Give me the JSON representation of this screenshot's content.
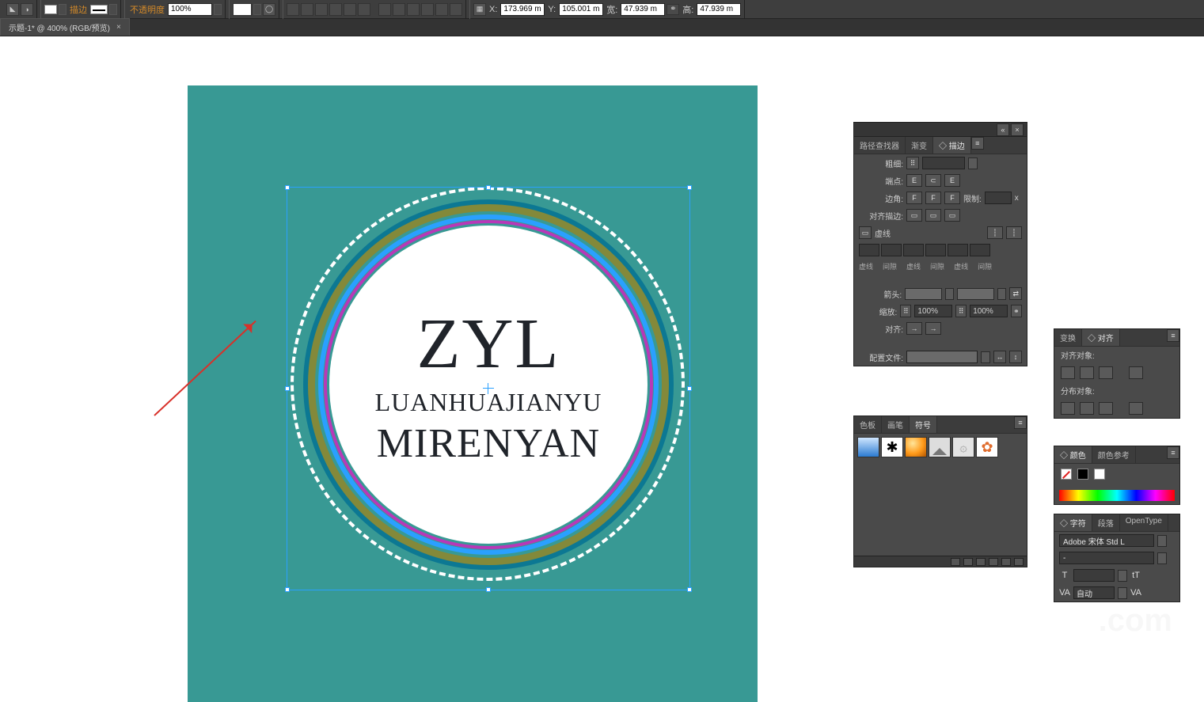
{
  "topbar": {
    "stroke_label": "描边",
    "opacity_label": "不透明度",
    "opacity_value": "100%",
    "x_label": "X:",
    "x_value": "173.969 m",
    "y_label": "Y:",
    "y_value": "105.001 m",
    "w_label": "宽:",
    "w_value": "47.939 m",
    "h_label": "高:",
    "h_value": "47.939 m"
  },
  "document_tab": {
    "title": "示题-1* @ 400% (RGB/预览)",
    "close": "×"
  },
  "artwork": {
    "line1": "ZYL",
    "line2": "LUANHUAJIANYU",
    "line3": "MIRENYAN"
  },
  "stroke_panel": {
    "tabs": [
      "路径查找器",
      "渐变",
      "◇ 描边"
    ],
    "weight_label": "粗细:",
    "cap_label": "端点:",
    "corner_label": "边角:",
    "limit_label": "限制:",
    "align_stroke_label": "对齐描边:",
    "dash_label": "虚线",
    "dash_cols": [
      "虚线",
      "间隙",
      "虚线",
      "间隙",
      "虚线",
      "间隙"
    ],
    "arrow_label": "箭头:",
    "scale_label": "缩放:",
    "scale_value_a": "100%",
    "scale_value_b": "100%",
    "align_tip_label": "对齐:",
    "profile_label": "配置文件:"
  },
  "symbols_panel": {
    "tabs": [
      "色板",
      "画笔",
      "符号"
    ]
  },
  "align_panel": {
    "tabs": [
      "变换",
      "◇ 对齐"
    ],
    "align_objects_label": "对齐对象:",
    "distribute_label": "分布对象:"
  },
  "color_panel": {
    "tabs": [
      "◇ 颜色",
      "颜色参考"
    ]
  },
  "char_panel": {
    "tabs": [
      "◇ 字符",
      "段落",
      "OpenType"
    ],
    "font_family": "Adobe 宋体 Std L",
    "font_style": "-",
    "kerning_value": "自动"
  },
  "watermark": ".com"
}
